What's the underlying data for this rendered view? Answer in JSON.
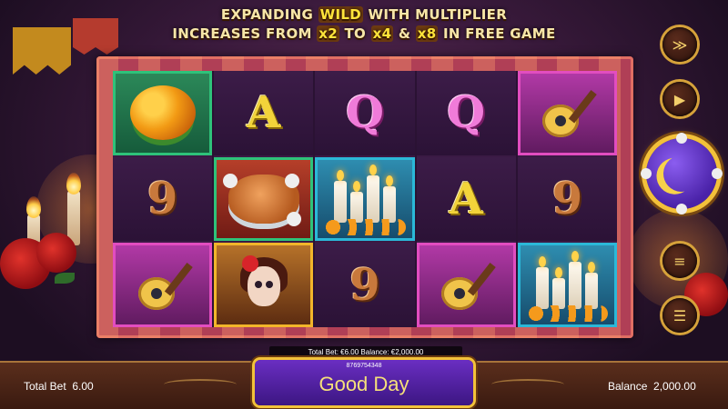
{
  "promo": {
    "line1_a": "EXPANDING ",
    "line1_wild": "WILD",
    "line1_b": " WITH MULTIPLIER",
    "line2_a": "INCREASES FROM ",
    "line2_x2": "x2",
    "line2_b": " TO ",
    "line2_x4": "x4",
    "line2_c": " & ",
    "line2_x8": "x8",
    "line2_d": " IN FREE GAME"
  },
  "reels": [
    [
      {
        "symbol": "marigold",
        "border": "green"
      },
      {
        "symbol": "9"
      },
      {
        "symbol": "guitar",
        "border": "pink"
      }
    ],
    [
      {
        "symbol": "A"
      },
      {
        "symbol": "bread",
        "border": "green"
      },
      {
        "symbol": "catrina",
        "border": "gold"
      }
    ],
    [
      {
        "symbol": "Q"
      },
      {
        "symbol": "candles",
        "border": "cyan"
      },
      {
        "symbol": "9"
      }
    ],
    [
      {
        "symbol": "Q"
      },
      {
        "symbol": "A"
      },
      {
        "symbol": "guitar",
        "border": "pink"
      }
    ],
    [
      {
        "symbol": "guitar",
        "border": "pink"
      },
      {
        "symbol": "9"
      },
      {
        "symbol": "candles",
        "border": "cyan"
      }
    ]
  ],
  "side_buttons": {
    "turbo": "turbo-icon",
    "autoplay": "autoplay-icon",
    "spin": "spin-icon",
    "bet": "coins-icon",
    "menu": "menu-icon"
  },
  "footer": {
    "bet_strip": "Total Bet: €6.00   Balance: €2,000.00",
    "total_bet_label": "Total Bet",
    "total_bet_value": "6.00",
    "balance_label": "Balance",
    "balance_value": "2,000.00",
    "round_id": "8769754348",
    "message": "Good Day"
  },
  "colors": {
    "accent_gold": "#f2c23a",
    "spin_purple": "#4a22a8",
    "frame_red": "#b03f56"
  }
}
